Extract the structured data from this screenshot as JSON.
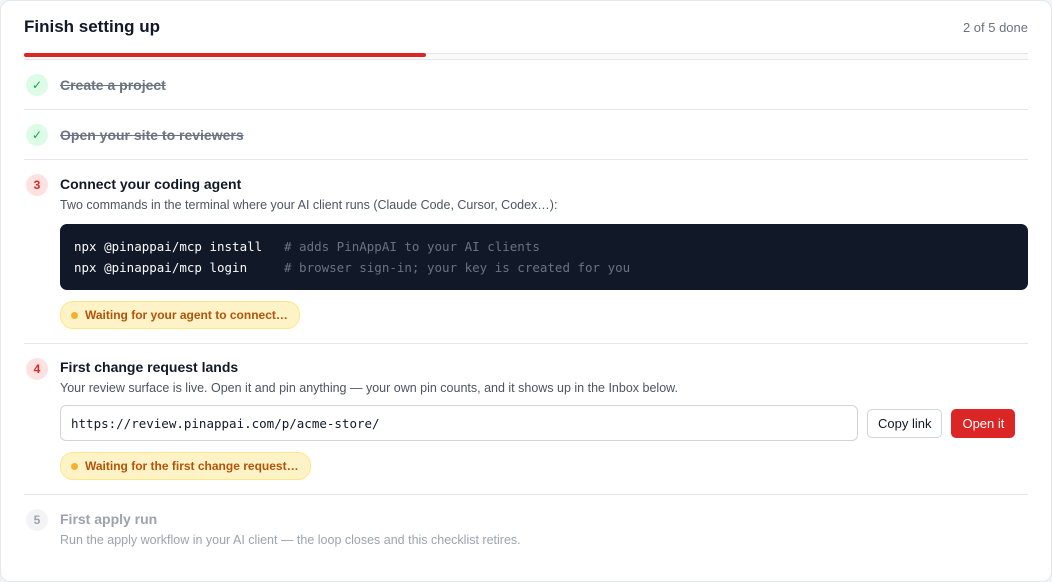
{
  "header": {
    "title": "Finish setting up",
    "progress_text": "2 of 5 done",
    "progress_value": 0.4
  },
  "steps": [
    {
      "number": "✓",
      "status": "done",
      "title": "Create a project"
    },
    {
      "number": "✓",
      "status": "done",
      "title": "Open your site to reviewers"
    },
    {
      "number": "3",
      "status": "active",
      "title": "Connect your coding agent",
      "description": "Two commands in the terminal where your AI client runs (Claude Code, Cursor, Codex…):",
      "commands": [
        {
          "cmd": "npx @pinappai/mcp install",
          "comment": "# adds PinAppAI to your AI clients"
        },
        {
          "cmd": "npx @pinappai/mcp login",
          "comment": "# browser sign-in; your key is created for you"
        }
      ],
      "status_text": "Waiting for your agent to connect…"
    },
    {
      "number": "4",
      "status": "active",
      "title": "First change request lands",
      "description": "Your review surface is live. Open it and pin anything — your own pin counts, and it shows up in the Inbox below.",
      "url": "https://review.pinappai.com/p/acme-store/",
      "copy_label": "Copy link",
      "open_label": "Open it",
      "status_text": "Waiting for the first change request…"
    },
    {
      "number": "5",
      "status": "pending",
      "title": "First apply run",
      "description": "Run the apply workflow in your AI client — the loop closes and this checklist retires."
    }
  ],
  "colors": {
    "accent": "#dc2626",
    "done": "#16a34a",
    "waiting": "#b45309",
    "code_bg": "#111827"
  }
}
